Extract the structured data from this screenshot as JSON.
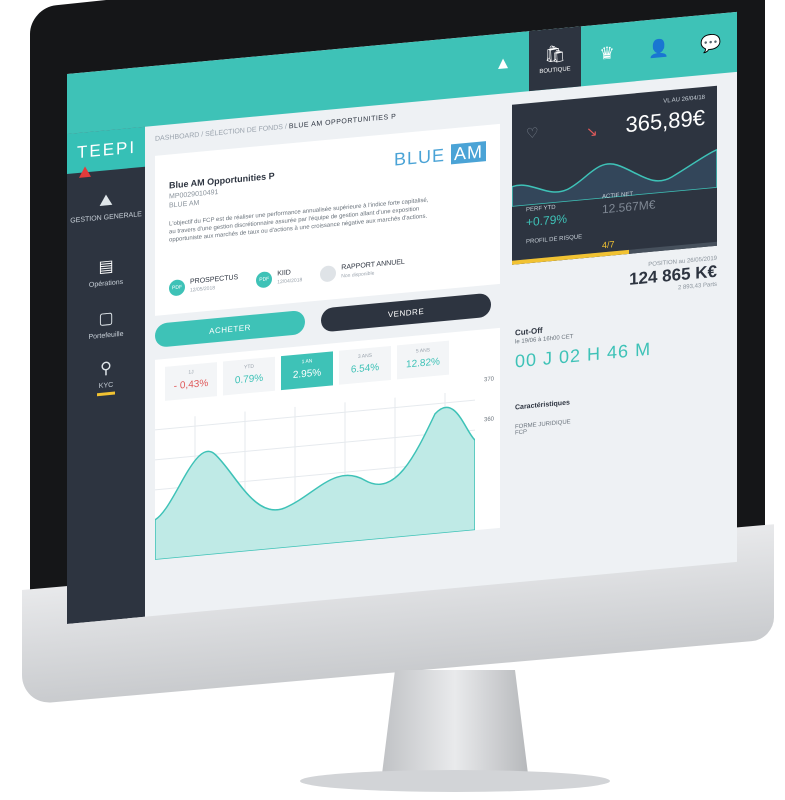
{
  "app": {
    "logo": "TEEPI"
  },
  "sidebar": {
    "items": [
      {
        "label": "GESTION GENERALE",
        "icon": "mountain-icon"
      },
      {
        "label": "Opérations",
        "icon": "document-icon"
      },
      {
        "label": "Portefeuille",
        "icon": "wallet-icon"
      },
      {
        "label": "KYC",
        "icon": "person-icon"
      }
    ]
  },
  "topbar": {
    "active_label": "BOUTIQUE"
  },
  "breadcrumb": {
    "path": "DASHBOARD / SÉLECTION DE FONDS /",
    "current": "BLUE AM OPPORTUNITIES P"
  },
  "fund": {
    "brand_text": "BLUE",
    "brand_box": "AM",
    "name": "Blue AM Opportunities P",
    "isin": "MP0029010491",
    "manager": "BLUE AM",
    "description": "L'objectif du FCP est de réaliser une performance annualisée supérieure à l'indice forte capitalisé, au travers d'une gestion discrétionnaire assurée par l'équipe de gestion allant d'une exposition opportuniste aux marchés de taux ou d'actions à une croissance négative aux marchés d'actions.",
    "docs": [
      {
        "badge": "PDF",
        "title": "PROSPECTUS",
        "sub": "12/05/2018"
      },
      {
        "badge": "PDF",
        "title": "KIID",
        "sub": "12/04/2018"
      },
      {
        "badge": "",
        "title": "RAPPORT ANNUEL",
        "sub": "Non disponible"
      }
    ]
  },
  "actions": {
    "buy": "ACHETER",
    "sell": "VENDRE"
  },
  "vl": {
    "date_label": "VL AU 26/04/18",
    "value": "365,89€",
    "perf_label": "PERF YTD",
    "perf_value": "+0.79%",
    "actif_label": "ACTIF NET",
    "actif_value": "12.567M€",
    "risk_label": "PROFIL DE RISQUE",
    "risk_value": "4/7",
    "risk_level": 0.57
  },
  "position": {
    "label": "POSITION au 26/05/2019",
    "value": "124 865 K€",
    "parts": "2 893,43 Parts"
  },
  "periods": [
    {
      "label": "1J",
      "value": "- 0,43%",
      "neg": true
    },
    {
      "label": "YTD",
      "value": "0.79%"
    },
    {
      "label": "1 AN",
      "value": "2.95%",
      "selected": true
    },
    {
      "label": "3 ANS",
      "value": "6.54%"
    },
    {
      "label": "5 ANS",
      "value": "12.82%"
    }
  ],
  "chart": {
    "y_labels": [
      "370",
      "360"
    ]
  },
  "cutoff": {
    "title": "Cut-Off",
    "sub": "le 19/06 à 16h00 CET",
    "countdown": "00 J 02 H 46 M"
  },
  "characteristics": {
    "title": "Caractéristiques",
    "forme": "FORME JURIDIQUE",
    "forme_val": "FCP"
  },
  "colors": {
    "accent": "#3ec2b7",
    "dark": "#2d3440",
    "warning": "#f1c232",
    "negative": "#e05a5a"
  }
}
